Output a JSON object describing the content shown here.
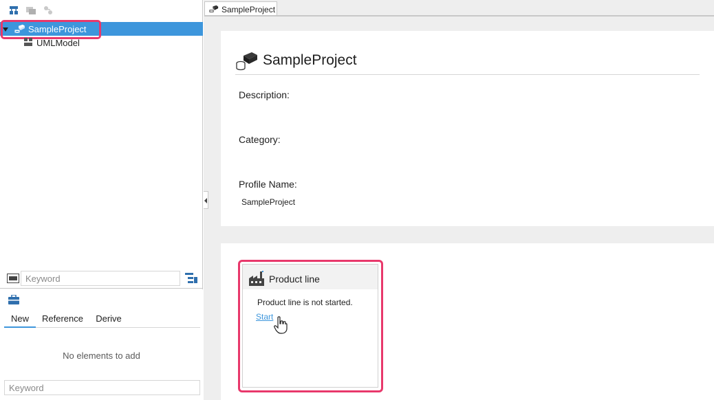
{
  "tree": {
    "project_label": "SampleProject",
    "uml_label": "UMLModel"
  },
  "left_search": {
    "placeholder": "Keyword"
  },
  "toolbox": {
    "tabs": [
      "New",
      "Reference",
      "Derive"
    ],
    "active_tab": "New",
    "empty_message": "No elements to add",
    "search_placeholder": "Keyword"
  },
  "document_tab": {
    "label": "SampleProject"
  },
  "project_info": {
    "title": "SampleProject",
    "description_label": "Description:",
    "category_label": "Category:",
    "profile_label": "Profile Name:",
    "profile_value": "SampleProject"
  },
  "product_line": {
    "title": "Product line",
    "status": "Product line is not started.",
    "start_link": "Start"
  },
  "colors": {
    "selection": "#3d96dc",
    "highlight": "#e8386b",
    "link": "#3d96dc",
    "icon_blue": "#2f6fad"
  },
  "icons": [
    "hierarchy-icon",
    "diagram-icon",
    "model-icon",
    "project-icon",
    "uml-model-icon",
    "abc-icon",
    "filter-icon",
    "toolbox-icon",
    "factory-icon",
    "hand-cursor-icon"
  ]
}
